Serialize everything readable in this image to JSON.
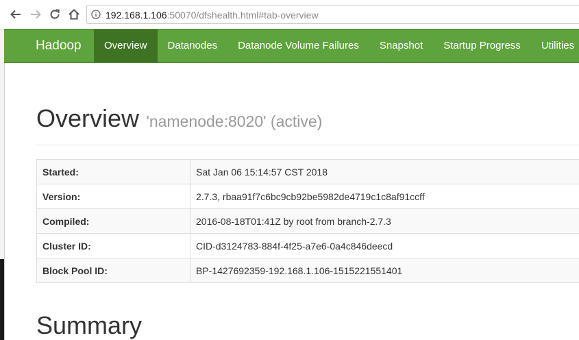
{
  "browser": {
    "url_host": "192.168.1.106",
    "url_rest": ":50070/dfshealth.html#tab-overview"
  },
  "navbar": {
    "brand": "Hadoop",
    "items": [
      {
        "label": "Overview",
        "active": true
      },
      {
        "label": "Datanodes"
      },
      {
        "label": "Datanode Volume Failures"
      },
      {
        "label": "Snapshot"
      },
      {
        "label": "Startup Progress"
      },
      {
        "label": "Utilities"
      }
    ]
  },
  "overview": {
    "title": "Overview",
    "subtitle": "'namenode:8020' (active)",
    "rows": [
      {
        "key": "Started:",
        "value": "Sat Jan 06 15:14:57 CST 2018"
      },
      {
        "key": "Version:",
        "value": "2.7.3, rbaa91f7c6bc9cb92be5982de4719c1c8af91ccff"
      },
      {
        "key": "Compiled:",
        "value": "2016-08-18T01:41Z by root from branch-2.7.3"
      },
      {
        "key": "Cluster ID:",
        "value": "CID-d3124783-884f-4f25-a7e6-0a4c846deecd"
      },
      {
        "key": "Block Pool ID:",
        "value": "BP-1427692359-192.168.1.106-1515221551401"
      }
    ]
  },
  "summary": {
    "title": "Summary"
  },
  "colors": {
    "navbar": "#5fa33e",
    "navbar_active": "#3e7324"
  }
}
